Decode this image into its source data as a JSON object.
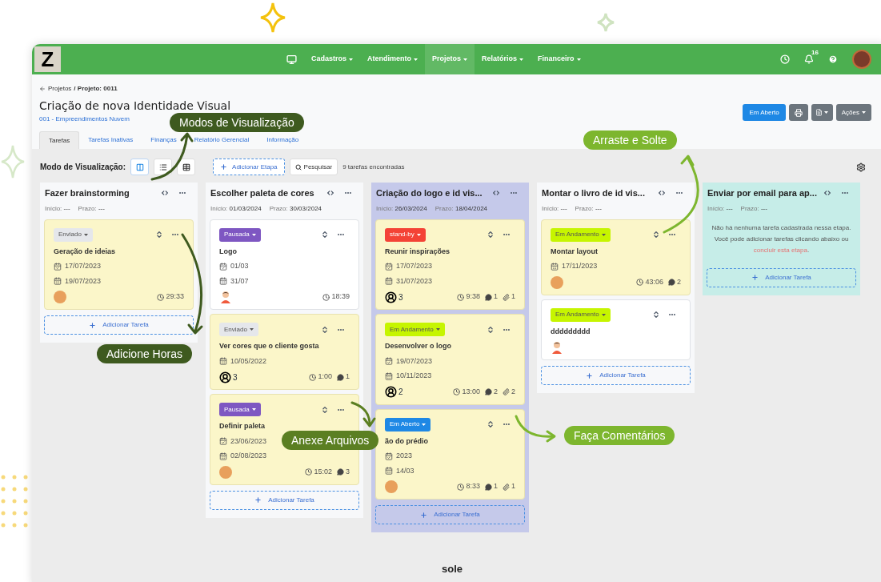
{
  "nav": {
    "logo": "Z",
    "menu": [
      {
        "label": "Cadastros",
        "selected": false
      },
      {
        "label": "Atendimento",
        "selected": false
      },
      {
        "label": "Projetos",
        "selected": true
      },
      {
        "label": "Relatórios",
        "selected": false
      },
      {
        "label": "Financeiro",
        "selected": false
      }
    ],
    "notification_count": "16"
  },
  "breadcrumb": {
    "back": "Projetos",
    "current": "/ Projeto: 0011"
  },
  "project": {
    "title": "Criação de nova Identidade Visual",
    "client": "001 - Empreendimentos Nuvem"
  },
  "actions": {
    "status": "Em Aberto",
    "more": "Ações"
  },
  "tabs": [
    {
      "label": "Tarefas",
      "selected": true
    },
    {
      "label": "Tarefas Inativas",
      "selected": false
    },
    {
      "label": "Finanças",
      "selected": false
    },
    {
      "label": "Relatório Gerencial",
      "selected": false
    },
    {
      "label": "Informação",
      "selected": false
    }
  ],
  "toolbar": {
    "view_label": "Modo de Visualização:",
    "view_modes": [
      {
        "kind": "kanban",
        "selected": true
      },
      {
        "kind": "list",
        "selected": false
      },
      {
        "kind": "table",
        "selected": false
      }
    ],
    "add_stage": "Adicionar Etapa",
    "search": "Pesquisar",
    "count": "9 tarefas encontradas"
  },
  "columns": [
    {
      "title": "Fazer brainstorming",
      "color": "#f7f8fa",
      "start_label": "Início:",
      "start": "---",
      "due_label": "Prazo:",
      "due": "---",
      "add": "Adicionar Tarefa",
      "cards": [
        {
          "highlighted": true,
          "status": {
            "label": "Enviado",
            "color": "#e5e7eb"
          },
          "title": "Geração de ideias",
          "dates": [
            {
              "kind": "start",
              "text": "17/07/2023"
            },
            {
              "kind": "due",
              "text": "19/07/2023"
            }
          ],
          "assignee": {
            "kind": "female"
          },
          "time": "29:33"
        }
      ]
    },
    {
      "title": "Escolher paleta de cores",
      "color": "#f7f8fa",
      "start_label": "Início:",
      "start": "01/03/2024",
      "due_label": "Prazo:",
      "due": "30/03/2024",
      "add": "Adicionar Tarefa",
      "cards": [
        {
          "highlighted": false,
          "status": {
            "label": "Pausada",
            "color": "#7e57c2"
          },
          "title": "Logo",
          "dates": [
            {
              "kind": "start",
              "text": "01/03"
            },
            {
              "kind": "due",
              "text": "31/07"
            }
          ],
          "assignee": {
            "kind": "male"
          },
          "time": "18:39"
        },
        {
          "highlighted": true,
          "status": {
            "label": "Enviado",
            "color": "#e5e7eb"
          },
          "title": "Ver cores que o cliente gosta",
          "dates": [
            {
              "kind": "due",
              "text": "10/05/2022"
            }
          ],
          "assignee": {
            "kind": "group",
            "count": "3"
          },
          "time": "1:00",
          "comments": "1"
        },
        {
          "highlighted": true,
          "status": {
            "label": "Pausada",
            "color": "#7e57c2"
          },
          "title": "Definir paleta",
          "dates": [
            {
              "kind": "start",
              "text": "23/06/2023"
            },
            {
              "kind": "due",
              "text": "02/08/2023"
            }
          ],
          "assignee": {
            "kind": "female"
          },
          "time": "15:02",
          "comments": "3"
        }
      ]
    },
    {
      "title": "Criação do logo e id vis...",
      "color": "#c5c9ea",
      "start_label": "Início:",
      "start": "26/03/2024",
      "due_label": "Prazo:",
      "due": "18/04/2024",
      "add": "Adicionar Tarefa",
      "cards": [
        {
          "highlighted": true,
          "status": {
            "label": "stand-by",
            "color": "#f44336"
          },
          "title": "Reunir inspirações",
          "dates": [
            {
              "kind": "start",
              "text": "17/07/2023"
            },
            {
              "kind": "due",
              "text": "31/07/2023"
            }
          ],
          "assignee": {
            "kind": "group",
            "count": "3"
          },
          "time": "9:38",
          "comments": "1",
          "attachments": "1"
        },
        {
          "highlighted": true,
          "status": {
            "label": "Em Andamento",
            "color": "#c6f500"
          },
          "title": "Desenvolver o logo",
          "dates": [
            {
              "kind": "start",
              "text": "19/07/2023"
            },
            {
              "kind": "due",
              "text": "10/11/2023"
            }
          ],
          "assignee": {
            "kind": "group",
            "count": "2"
          },
          "time": "13:00",
          "comments": "2",
          "attachments": "2"
        },
        {
          "highlighted": true,
          "status": {
            "label": "Em Aberto",
            "color": "#1e88e5"
          },
          "title": "ão do prédio",
          "dates": [
            {
              "kind": "start",
              "text": "2023"
            },
            {
              "kind": "due",
              "text": "14/03"
            }
          ],
          "assignee": {
            "kind": "female"
          },
          "time": "8:33",
          "comments": "1",
          "attachments": "1"
        }
      ]
    },
    {
      "title": "Montar o livro de id vis...",
      "color": "#f7f8fa",
      "start_label": "Início:",
      "start": "---",
      "due_label": "Prazo:",
      "due": "---",
      "add": "Adicionar Tarefa",
      "cards": [
        {
          "highlighted": true,
          "status": {
            "label": "Em Andamento",
            "color": "#c6f500"
          },
          "title": "Montar layout",
          "dates": [
            {
              "kind": "due",
              "text": "17/11/2023"
            }
          ],
          "assignee": {
            "kind": "female"
          },
          "time": "43:06",
          "comments": "2"
        },
        {
          "highlighted": false,
          "status": {
            "label": "Em Andamento",
            "color": "#c6f500"
          },
          "title": "ddddddddd",
          "assignee": {
            "kind": "male"
          }
        }
      ]
    },
    {
      "title": "Enviar por email para ap...",
      "color": "#c6ede8",
      "start_label": "Início:",
      "start": "---",
      "due_label": "Prazo:",
      "due": "---",
      "add": "Adicionar Tarefa",
      "empty": {
        "text": "Não há nenhuma tarefa cadastrada nessa etapa. Você pode adicionar tarefas clicando abaixo ou",
        "link": "concluir esta etapa",
        "end": "."
      }
    }
  ],
  "callouts": [
    "Modos de Visualização",
    "Arraste e Solte",
    "Adicione Horas",
    "Anexe Arquivos",
    "Faça Comentários"
  ],
  "footer_logo": "sole"
}
